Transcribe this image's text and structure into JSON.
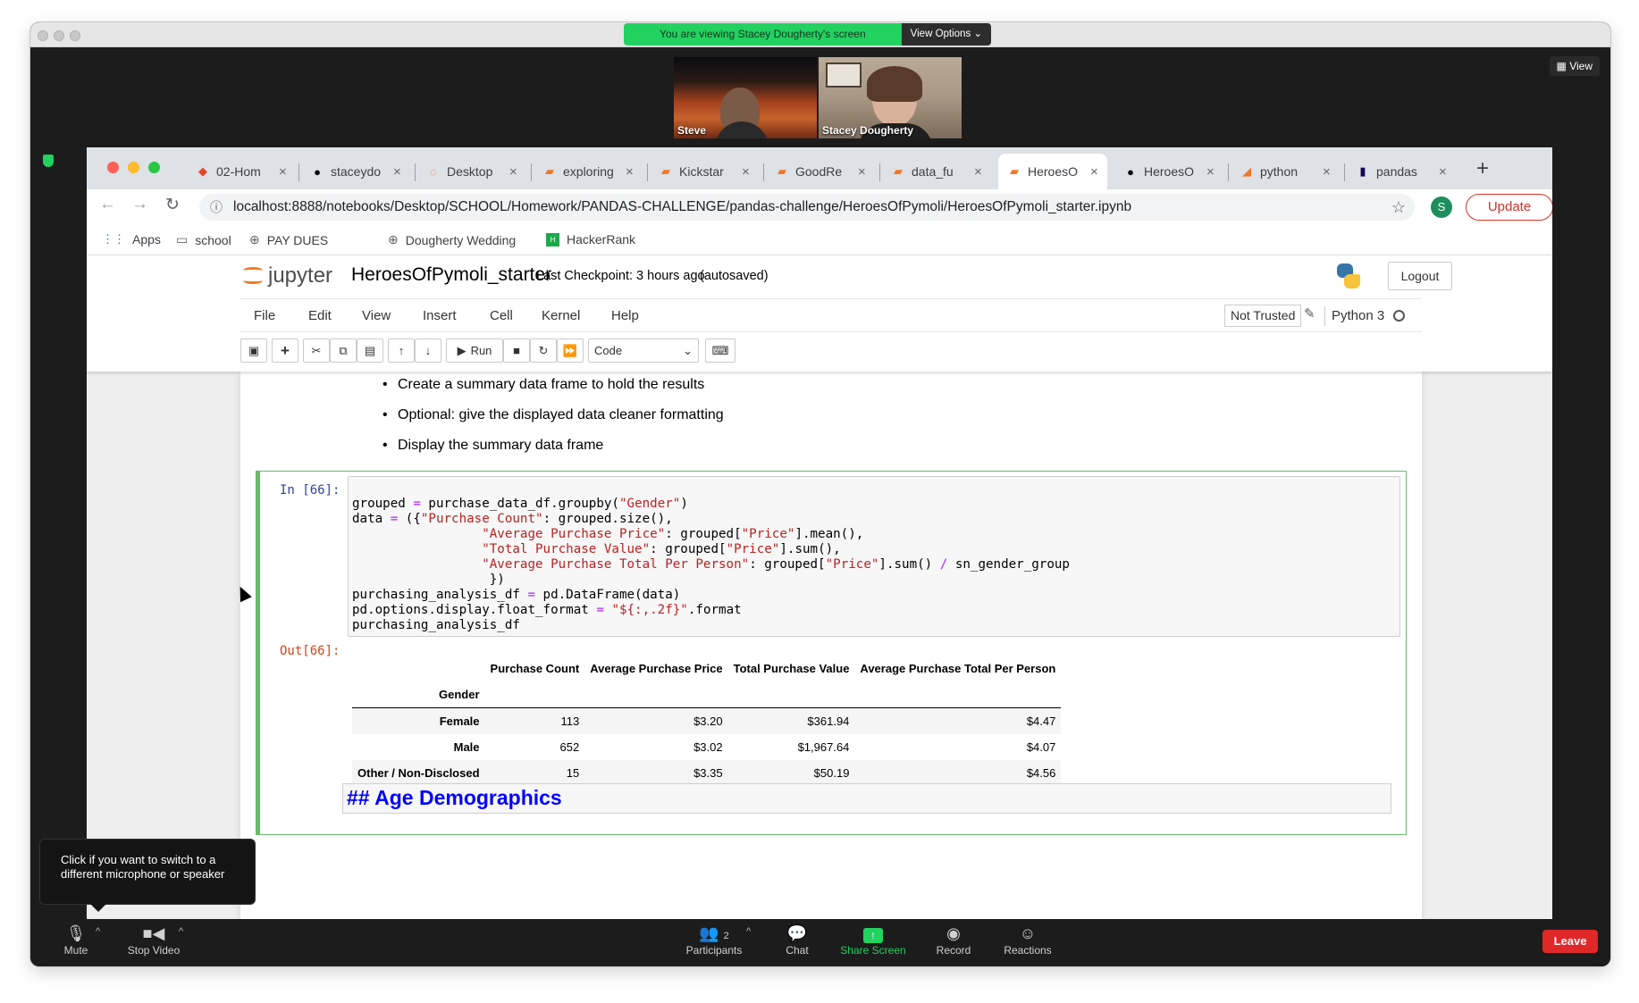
{
  "zoom": {
    "share_banner": "You are viewing Stacey Dougherty's screen",
    "view_options": "View Options",
    "view_button": "View",
    "participants": [
      {
        "name": "Steve"
      },
      {
        "name": "Stacey Dougherty"
      }
    ],
    "controls": {
      "mute": "Mute",
      "stop_video": "Stop Video",
      "participants": "Participants",
      "participants_count": "2",
      "chat": "Chat",
      "share_screen": "Share Screen",
      "record": "Record",
      "reactions": "Reactions",
      "leave": "Leave"
    },
    "tooltip": "Click if you want to switch to a different microphone or speaker"
  },
  "browser": {
    "tabs": [
      {
        "label": "02-Hom",
        "icon": "gitlab-icon"
      },
      {
        "label": "staceydo",
        "icon": "github-icon"
      },
      {
        "label": "Desktop",
        "icon": "jupyter-spinner-icon"
      },
      {
        "label": "exploring",
        "icon": "notebook-icon"
      },
      {
        "label": "Kickstar",
        "icon": "notebook-icon"
      },
      {
        "label": "GoodRe",
        "icon": "notebook-icon"
      },
      {
        "label": "data_fu",
        "icon": "notebook-icon"
      },
      {
        "label": "HeroesO",
        "icon": "notebook-icon",
        "active": true
      },
      {
        "label": "HeroesO",
        "icon": "github-icon"
      },
      {
        "label": "python",
        "icon": "python-icon"
      },
      {
        "label": "pandas",
        "icon": "pandas-icon"
      }
    ],
    "url": "localhost:8888/notebooks/Desktop/SCHOOL/Homework/PANDAS-CHALLENGE/pandas-challenge/HeroesOfPymoli/HeroesOfPymoli_starter.ipynb",
    "profile_initial": "S",
    "update_label": "Update",
    "bookmarks": [
      "Apps",
      "school",
      "PAY DUES",
      "Dougherty Wedding",
      "HackerRank"
    ]
  },
  "jupyter": {
    "logo_text": "jupyter",
    "notebook_name": "HeroesOfPymoli_starter",
    "checkpoint": "Last Checkpoint: 3 hours ago",
    "autosaved": "(autosaved)",
    "logout": "Logout",
    "menu": [
      "File",
      "Edit",
      "View",
      "Insert",
      "Cell",
      "Kernel",
      "Help"
    ],
    "not_trusted": "Not Trusted",
    "kernel": "Python 3",
    "run_label": "Run",
    "cell_type": "Code"
  },
  "notebook": {
    "bullets": [
      "Create a summary data frame to hold the results",
      "Optional: give the displayed data cleaner formatting",
      "Display the summary data frame"
    ],
    "in_prompt": "In [66]:",
    "out_prompt": "Out[66]:",
    "code_lines": [
      "grouped = purchase_data_df.groupby(\"Gender\")",
      "data = ({\"Purchase Count\": grouped.size(),",
      "                 \"Average Purchase Price\": grouped[\"Price\"].mean(),",
      "                 \"Total Purchase Value\": grouped[\"Price\"].sum(),",
      "                 \"Average Purchase Total Per Person\": grouped[\"Price\"].sum() / sn_gender_group",
      "                  })",
      "purchasing_analysis_df = pd.DataFrame(data)",
      "pd.options.display.float_format = \"${:,.2f}\".format",
      "purchasing_analysis_df"
    ],
    "table": {
      "columns": [
        "Purchase Count",
        "Average Purchase Price",
        "Total Purchase Value",
        "Average Purchase Total Per Person"
      ],
      "index_name": "Gender",
      "rows": [
        {
          "label": "Female",
          "values": [
            "113",
            "$3.20",
            "$361.94",
            "$4.47"
          ]
        },
        {
          "label": "Male",
          "values": [
            "652",
            "$3.02",
            "$1,967.64",
            "$4.07"
          ]
        },
        {
          "label": "Other / Non-Disclosed",
          "values": [
            "15",
            "$3.35",
            "$50.19",
            "$4.56"
          ]
        }
      ]
    },
    "markdown_heading": "## Age Demographics"
  }
}
